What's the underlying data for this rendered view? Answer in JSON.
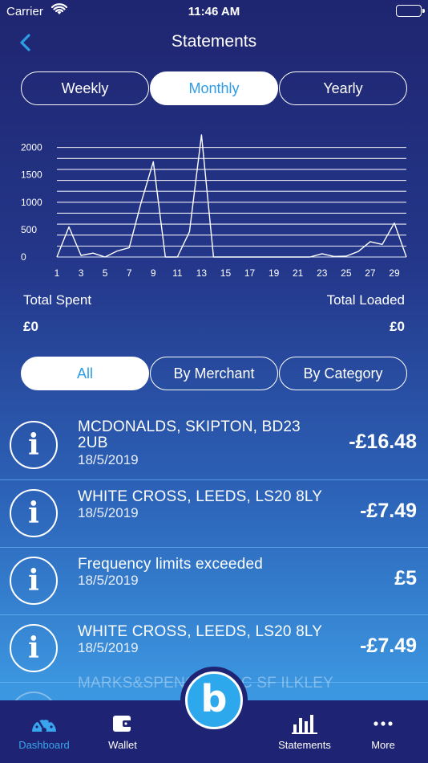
{
  "status_bar": {
    "carrier": "Carrier",
    "time": "11:46 AM"
  },
  "nav": {
    "title": "Statements"
  },
  "period_tabs": [
    {
      "label": "Weekly",
      "active": false
    },
    {
      "label": "Monthly",
      "active": true
    },
    {
      "label": "Yearly",
      "active": false
    }
  ],
  "chart_data": {
    "type": "line",
    "x": [
      1,
      2,
      3,
      4,
      5,
      6,
      7,
      8,
      9,
      10,
      11,
      12,
      13,
      14,
      15,
      16,
      17,
      18,
      19,
      20,
      21,
      22,
      23,
      24,
      25,
      26,
      27,
      28,
      29,
      30
    ],
    "series": [
      {
        "values": [
          0,
          550,
          30,
          70,
          0,
          110,
          170,
          1000,
          1740,
          0,
          0,
          460,
          2230,
          0,
          0,
          0,
          0,
          0,
          0,
          0,
          0,
          0,
          60,
          10,
          15,
          100,
          280,
          230,
          620,
          0
        ]
      }
    ],
    "x_ticks": [
      "1",
      "3",
      "5",
      "7",
      "9",
      "11",
      "13",
      "15",
      "17",
      "19",
      "21",
      "23",
      "25",
      "27",
      "29"
    ],
    "y_ticks": [
      "0",
      "500",
      "1000",
      "1500",
      "2000"
    ],
    "ylim": [
      0,
      2200
    ],
    "grid": true,
    "line_color": "#ffffff",
    "grid_color": "#ffffff"
  },
  "totals": {
    "spent_label": "Total Spent",
    "loaded_label": "Total Loaded",
    "spent_value": "£0",
    "loaded_value": "£0"
  },
  "filter_tabs": [
    {
      "label": "All",
      "active": true
    },
    {
      "label": "By Merchant",
      "active": false
    },
    {
      "label": "By Category",
      "active": false
    }
  ],
  "transactions": [
    {
      "merchant": "MCDONALDS, SKIPTON, BD23 2UB",
      "date": "18/5/2019",
      "amount": "-£16.48"
    },
    {
      "merchant": "WHITE CROSS, LEEDS, LS20 8LY",
      "date": "18/5/2019",
      "amount": "-£7.49"
    },
    {
      "merchant": "Frequency limits exceeded",
      "date": "18/5/2019",
      "amount": "£5"
    },
    {
      "merchant": "WHITE CROSS, LEEDS, LS20 8LY",
      "date": "18/5/2019",
      "amount": "-£7.49"
    },
    {
      "merchant": "MARKS&SPENCER PLC SF ILKLEY",
      "date": "",
      "amount": ""
    }
  ],
  "tabbar": {
    "dashboard": "Dashboard",
    "wallet": "Wallet",
    "statements": "Statements",
    "more": "More",
    "center_glyph": "b"
  },
  "colors": {
    "accent": "#2d9de6",
    "tabbar": "#1e2473",
    "active_tab": "#3aa5ee"
  }
}
